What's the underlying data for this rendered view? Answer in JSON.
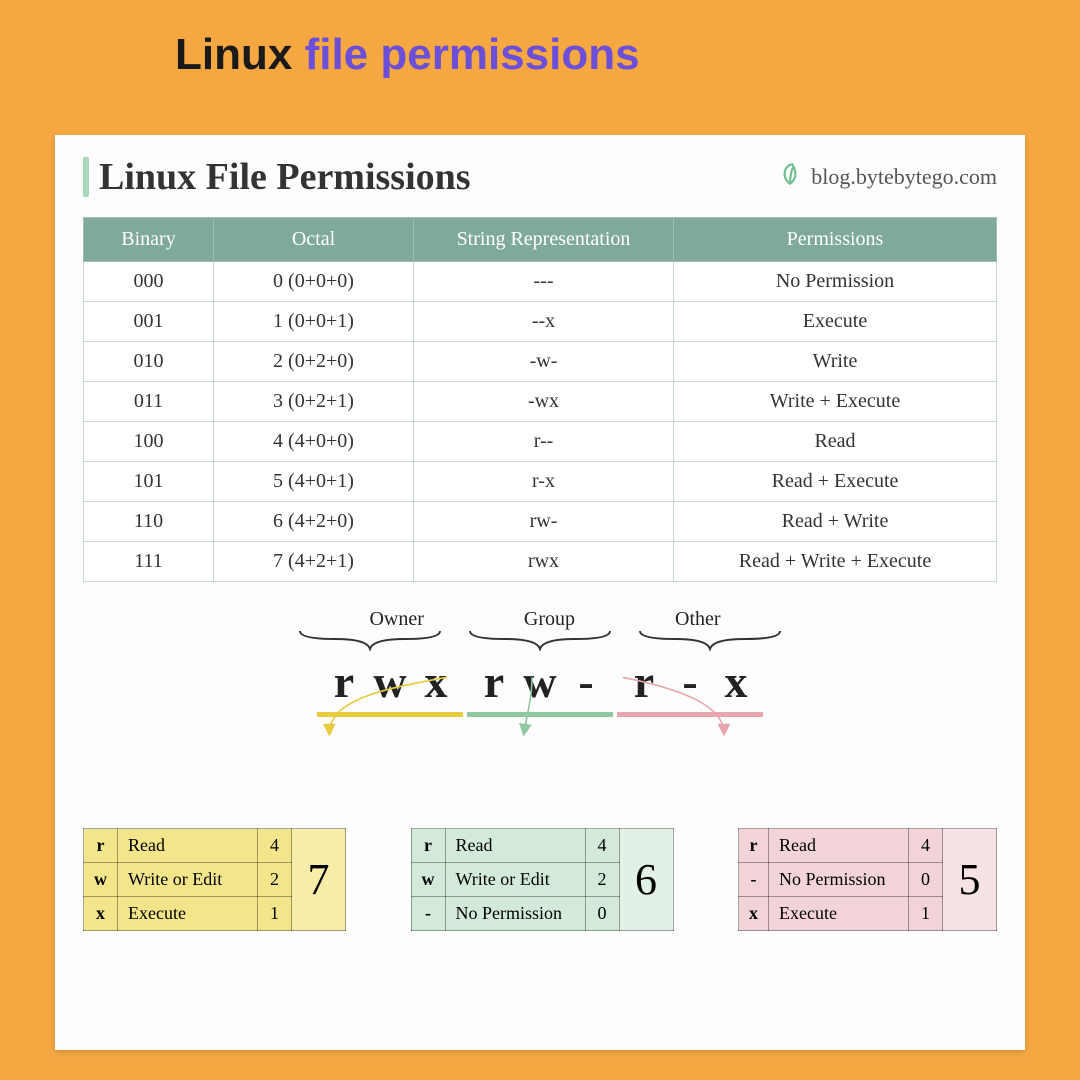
{
  "outer_title": {
    "part1": "Linux",
    "part2": "file permissions"
  },
  "card": {
    "title": "Linux File Permissions",
    "brand": "blog.bytebytego.com"
  },
  "table": {
    "headers": [
      "Binary",
      "Octal",
      "String Representation",
      "Permissions"
    ],
    "rows": [
      {
        "binary": "000",
        "octal": "0 (0+0+0)",
        "str": "---",
        "perm": "No Permission"
      },
      {
        "binary": "001",
        "octal": "1 (0+0+1)",
        "str": "--x",
        "perm": "Execute"
      },
      {
        "binary": "010",
        "octal": "2 (0+2+0)",
        "str": "-w-",
        "perm": "Write"
      },
      {
        "binary": "011",
        "octal": "3 (0+2+1)",
        "str": "-wx",
        "perm": "Write + Execute"
      },
      {
        "binary": "100",
        "octal": "4 (4+0+0)",
        "str": "r--",
        "perm": "Read"
      },
      {
        "binary": "101",
        "octal": "5 (4+0+1)",
        "str": "r-x",
        "perm": "Read + Execute"
      },
      {
        "binary": "110",
        "octal": "6 (4+2+0)",
        "str": "rw-",
        "perm": "Read + Write"
      },
      {
        "binary": "111",
        "octal": "7 (4+2+1)",
        "str": "rwx",
        "perm": "Read + Write + Execute"
      }
    ]
  },
  "breakdown": {
    "labels": [
      "Owner",
      "Group",
      "Other"
    ],
    "groups": [
      {
        "cls": "owner",
        "chars": [
          "r",
          "w",
          "x"
        ]
      },
      {
        "cls": "group",
        "chars": [
          "r",
          "w",
          "-"
        ]
      },
      {
        "cls": "other",
        "chars": [
          "r",
          "-",
          "x"
        ]
      }
    ]
  },
  "mini": [
    {
      "cls": "owner",
      "rows": [
        {
          "sym": "r",
          "label": "Read",
          "val": "4"
        },
        {
          "sym": "w",
          "label": "Write or Edit",
          "val": "2"
        },
        {
          "sym": "x",
          "label": "Execute",
          "val": "1"
        }
      ],
      "total": "7"
    },
    {
      "cls": "group",
      "rows": [
        {
          "sym": "r",
          "label": "Read",
          "val": "4"
        },
        {
          "sym": "w",
          "label": "Write or Edit",
          "val": "2"
        },
        {
          "sym": "-",
          "label": "No Permission",
          "val": "0"
        }
      ],
      "total": "6"
    },
    {
      "cls": "other",
      "rows": [
        {
          "sym": "r",
          "label": "Read",
          "val": "4"
        },
        {
          "sym": "-",
          "label": "No Permission",
          "val": "0"
        },
        {
          "sym": "x",
          "label": "Execute",
          "val": "1"
        }
      ],
      "total": "5"
    }
  ],
  "colors": {
    "owner": "#e8cc3f",
    "group": "#8fc7a0",
    "other": "#e6a6ad"
  }
}
